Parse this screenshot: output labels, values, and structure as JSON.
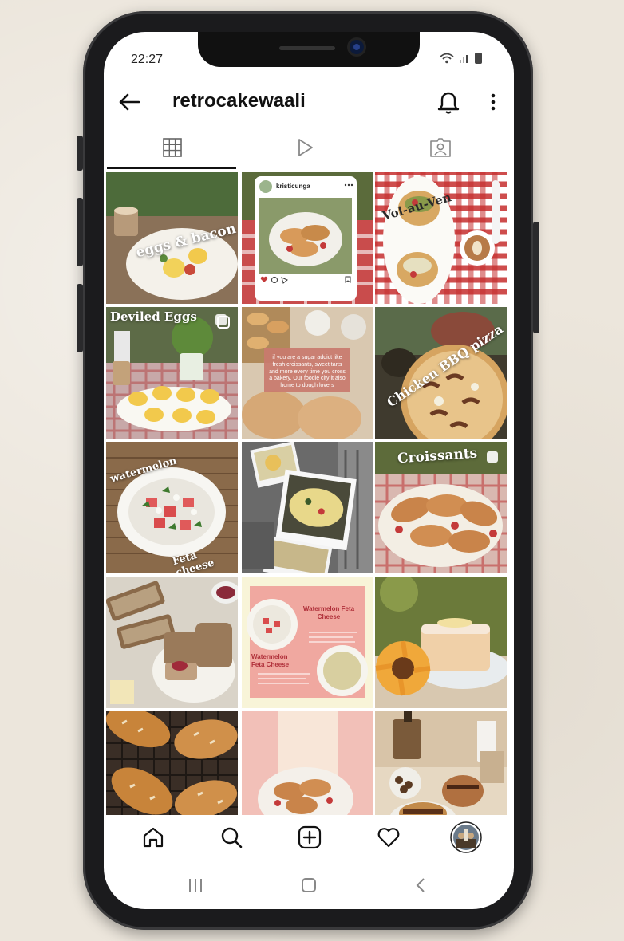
{
  "status_bar": {
    "time": "22:27"
  },
  "header": {
    "username": "retrocakewaali"
  },
  "posts": [
    {
      "overlay": "eggs & bacon"
    },
    {
      "inner_username": "kristicunga"
    },
    {
      "overlay": "Vol-au-Ven"
    },
    {
      "overlay": "Deviled Eggs"
    },
    {
      "caption": "if you are a sugar addict like fresh croissants, sweet tarts and more every time you cross a bakery. Our foodie city it also home to dough lovers"
    },
    {
      "overlay": "Chicken BBQ pizza"
    },
    {
      "overlay_top": "watermelon",
      "overlay_bottom": "Feta cheese"
    },
    {
      "overlay": ""
    },
    {
      "overlay": "Croissants"
    },
    {
      "overlay": ""
    },
    {
      "title_top": "Watermelon Feta Cheese",
      "title_bottom": "Watermelon Feta Cheese"
    },
    {
      "overlay": ""
    },
    {
      "overlay": ""
    },
    {
      "overlay": ""
    },
    {
      "overlay": ""
    }
  ],
  "colors": {
    "text": "#111111",
    "icon": "#222222",
    "background": "#ece6dc",
    "phone": "#1b1b1d"
  }
}
